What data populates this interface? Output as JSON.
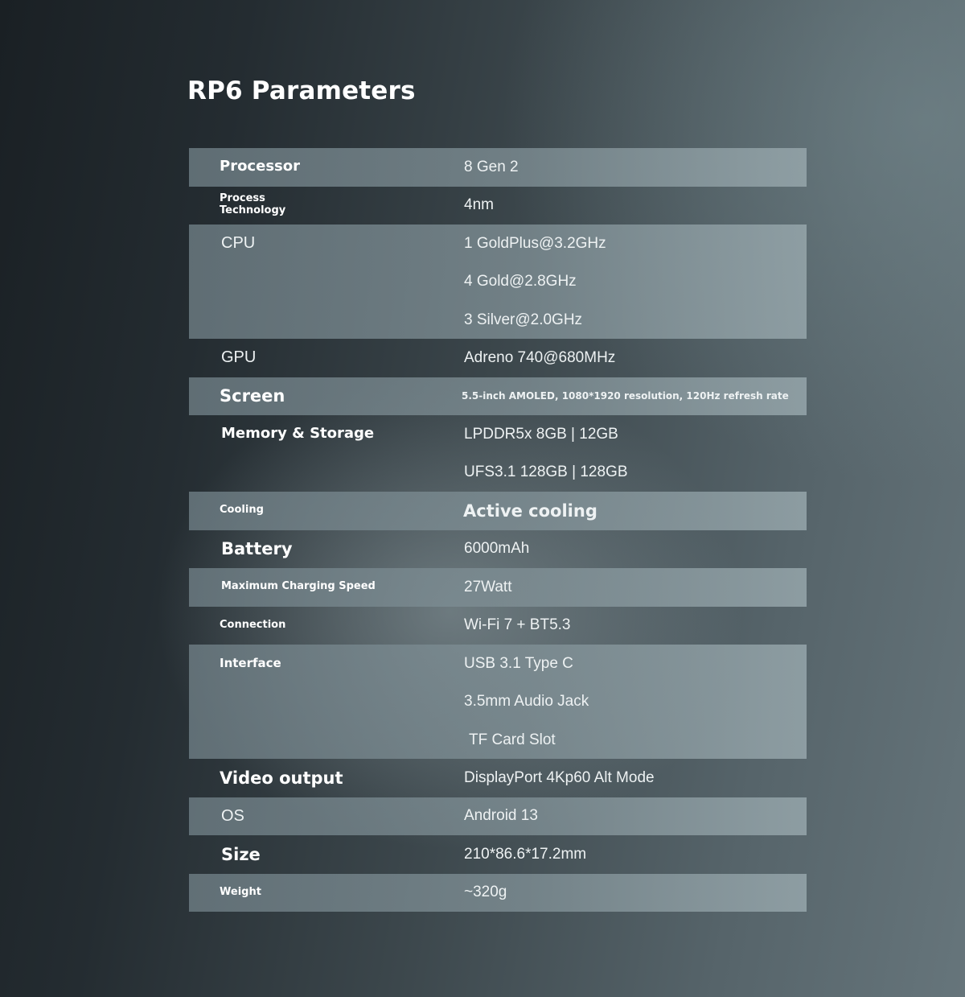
{
  "title": "RP6 Parameters",
  "specs": [
    {
      "label": "Processor",
      "values": [
        "8 Gen 2"
      ]
    },
    {
      "label": "Process\nTechnology",
      "values": [
        "4nm"
      ]
    },
    {
      "label": "CPU",
      "values": [
        "1 GoldPlus@3.2GHz",
        "4 Gold@2.8GHz",
        "3 Silver@2.0GHz"
      ]
    },
    {
      "label": "GPU",
      "values": [
        "Adreno 740@680MHz"
      ]
    },
    {
      "label": "Screen",
      "values": [
        "5.5-inch AMOLED, 1080*1920 resolution, 120Hz refresh rate"
      ]
    },
    {
      "label": "Memory & Storage",
      "values": [
        "LPDDR5x 8GB | 12GB",
        "UFS3.1 128GB | 128GB"
      ]
    },
    {
      "label": "Cooling",
      "values": [
        "Active cooling"
      ]
    },
    {
      "label": "Battery",
      "values": [
        "6000mAh"
      ]
    },
    {
      "label": "Maximum Charging Speed",
      "values": [
        "27Watt"
      ]
    },
    {
      "label": "Connection",
      "values": [
        "Wi-Fi 7 + BT5.3"
      ]
    },
    {
      "label": "Interface",
      "values": [
        "USB 3.1 Type C",
        "3.5mm Audio Jack",
        "TF Card Slot"
      ]
    },
    {
      "label": "Video output",
      "values": [
        "DisplayPort 4Kp60 Alt Mode"
      ]
    },
    {
      "label": "OS",
      "values": [
        "Android 13"
      ]
    },
    {
      "label": "Size",
      "values": [
        "210*86.6*17.2mm"
      ]
    },
    {
      "label": "Weight",
      "values": [
        "~320g"
      ]
    }
  ]
}
